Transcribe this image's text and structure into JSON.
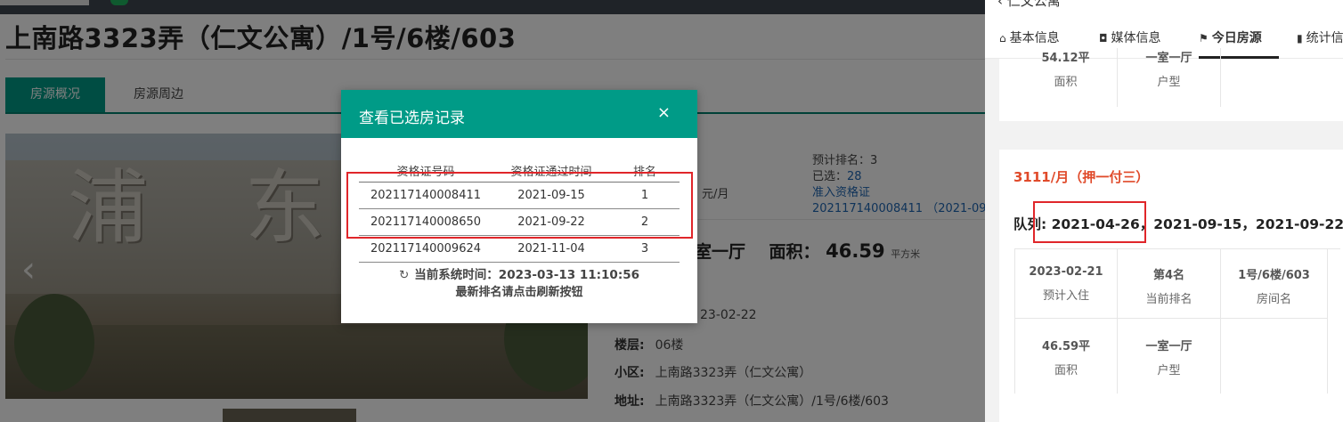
{
  "page": {
    "title": "上南路3323弄（仁文公寓）/1号/6楼/603",
    "tabs": [
      "房源概况",
      "房源周边"
    ]
  },
  "info": {
    "rank_label": "预计排名：3",
    "selected_label": "已选：",
    "selected_count": "28",
    "access_label": "准入资格证",
    "access_value": "202117140008411 （2021-09",
    "price_unit": "元/月",
    "layout": "室一厅",
    "area_label": "面积：",
    "area_value": "46.59",
    "area_unit": "平方米",
    "date_partial": "23-02-22",
    "floor_label": "楼层:",
    "floor_value": "06楼",
    "community_label": "小区:",
    "community_value": "上南路3323弄（仁文公寓）",
    "address_label": "地址:",
    "address_value": "上南路3323弄（仁文公寓）/1号/6楼/603"
  },
  "photo": {
    "sign_text": "浦 东 ⁠"
  },
  "modal": {
    "title": "查看已选房记录",
    "close_label": "×",
    "headers": [
      "资格证号码",
      "资格证通过时间",
      "排名"
    ],
    "rows": [
      {
        "cert": "202117140008411",
        "date": "2021-09-15",
        "rank": "1"
      },
      {
        "cert": "202117140008650",
        "date": "2021-09-22",
        "rank": "2"
      },
      {
        "cert": "202117140009624",
        "date": "2021-11-04",
        "rank": "3"
      }
    ],
    "systime_label": "当前系统时间：2023-03-13 11:10:56",
    "refresh_hint": "最新排名请点击刷新按钮"
  },
  "panel": {
    "back_title": "仁文公寓",
    "tabs": [
      {
        "icon": "⌂",
        "label": "基本信息"
      },
      {
        "icon": "◘",
        "label": "媒体信息"
      },
      {
        "icon": "⚑",
        "label": "今日房源"
      },
      {
        "icon": "▮",
        "label": "统计信"
      }
    ],
    "card1": {
      "area_value": "54.12平",
      "area_label": "面积",
      "layout_value": "一室一厅",
      "layout_label": "户型"
    },
    "card2": {
      "rent": "3111/月（押一付三）",
      "queue_label": "队列:",
      "queue_first": "2021-04-26，",
      "queue_rest": "2021-09-15，2021-09-22",
      "cells": [
        {
          "value": "2023-02-21",
          "label": "预计入住"
        },
        {
          "value": "第4名",
          "label": "当前排名"
        },
        {
          "value": "1号/6楼/603",
          "label": "房间名"
        },
        {
          "value": "46.59平",
          "label": "面积"
        },
        {
          "value": "一室一厅",
          "label": "户型"
        },
        {
          "value": "",
          "label": ""
        }
      ]
    }
  },
  "colors": {
    "accent": "#009b87",
    "highlight": "#e0262a",
    "rent": "#e04a2a"
  }
}
